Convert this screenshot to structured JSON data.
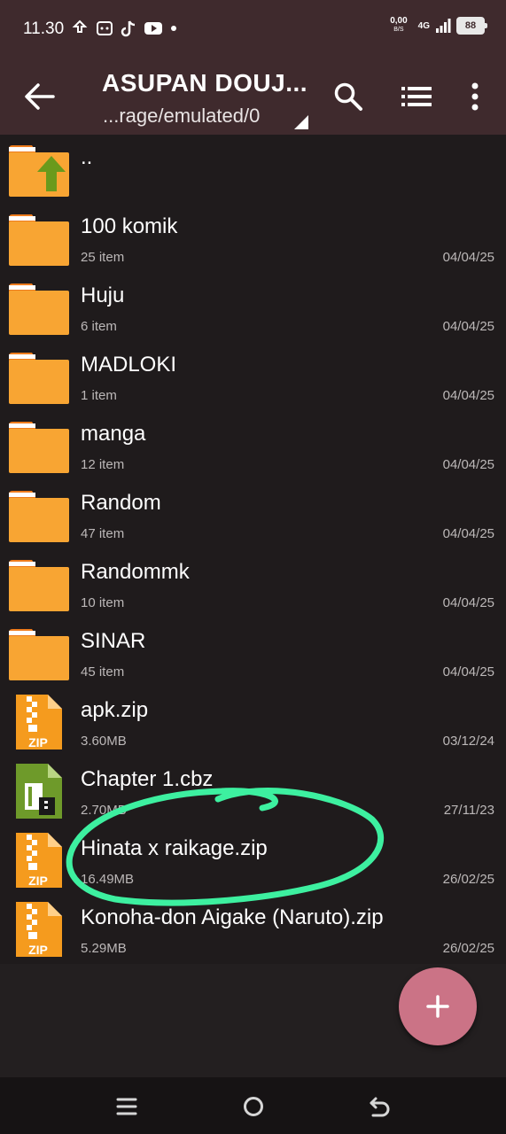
{
  "status_bar": {
    "time": "11.30",
    "net_speed_value": "0,00",
    "net_speed_unit": "B/S",
    "network_type": "4G",
    "battery": "88"
  },
  "toolbar": {
    "title": "ASUPAN DOUJ...",
    "path": "...rage/emulated/0"
  },
  "files": [
    {
      "name": "..",
      "type": "parent-folder",
      "meta": "",
      "date": ""
    },
    {
      "name": "100 komik",
      "type": "folder",
      "meta": "25 item",
      "date": "04/04/25"
    },
    {
      "name": "Huju",
      "type": "folder",
      "meta": "6 item",
      "date": "04/04/25"
    },
    {
      "name": "MADLOKI",
      "type": "folder",
      "meta": "1 item",
      "date": "04/04/25"
    },
    {
      "name": "manga",
      "type": "folder",
      "meta": "12 item",
      "date": "04/04/25"
    },
    {
      "name": "Random",
      "type": "folder",
      "meta": "47 item",
      "date": "04/04/25"
    },
    {
      "name": "Randommk",
      "type": "folder",
      "meta": "10 item",
      "date": "04/04/25"
    },
    {
      "name": "SINAR",
      "type": "folder",
      "meta": "45 item",
      "date": "04/04/25"
    },
    {
      "name": "apk.zip",
      "type": "zip",
      "meta": "3.60MB",
      "date": "03/12/24"
    },
    {
      "name": "Chapter 1.cbz",
      "type": "cbz",
      "meta": "2.70MB",
      "date": "27/11/23"
    },
    {
      "name": "Hinata x raikage.zip",
      "type": "zip",
      "meta": "16.49MB",
      "date": "26/02/25"
    },
    {
      "name": "Konoha-don Aigake (Naruto).zip",
      "type": "zip",
      "meta": "5.29MB",
      "date": "26/02/25"
    }
  ],
  "zip_badge": "ZIP",
  "colors": {
    "toolbar": "#3f2a2d",
    "background": "#1f1b1c",
    "folder": "#f8a533",
    "folder_tab": "#ee7c1d",
    "fab": "#cb7386",
    "highlight_stroke": "#3df0a0"
  }
}
